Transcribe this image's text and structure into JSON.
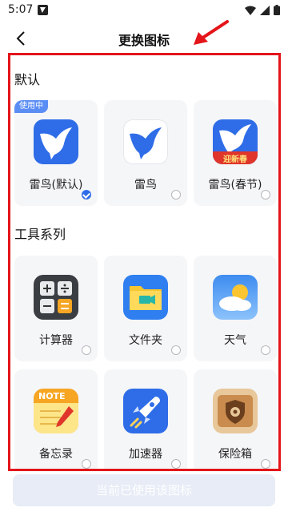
{
  "status_bar": {
    "time": "5:07"
  },
  "header": {
    "title": "更换图标"
  },
  "sections": [
    {
      "title": "默认",
      "items": [
        {
          "label": "雷鸟(默认)",
          "badge": "使用中",
          "selected": true,
          "icon": "bird-blue-icon"
        },
        {
          "label": "雷鸟",
          "selected": false,
          "icon": "bird-white-icon"
        },
        {
          "label": "雷鸟(春节)",
          "selected": false,
          "icon": "bird-spring-icon",
          "icon_text": "迎新春"
        }
      ]
    },
    {
      "title": "工具系列",
      "items": [
        {
          "label": "计算器",
          "selected": false,
          "icon": "calculator-icon"
        },
        {
          "label": "文件夹",
          "selected": false,
          "icon": "folder-icon"
        },
        {
          "label": "天气",
          "selected": false,
          "icon": "weather-icon"
        },
        {
          "label": "备忘录",
          "selected": false,
          "icon": "notepad-icon",
          "icon_text": "NOTE"
        },
        {
          "label": "加速器",
          "selected": false,
          "icon": "rocket-icon"
        },
        {
          "label": "保险箱",
          "selected": false,
          "icon": "safe-icon"
        }
      ]
    }
  ],
  "bottom_button": {
    "label": "当前已使用该图标"
  },
  "colors": {
    "accent": "#2f6de8",
    "annotation": "#e3151a",
    "card_bg": "#f5f6f8"
  }
}
